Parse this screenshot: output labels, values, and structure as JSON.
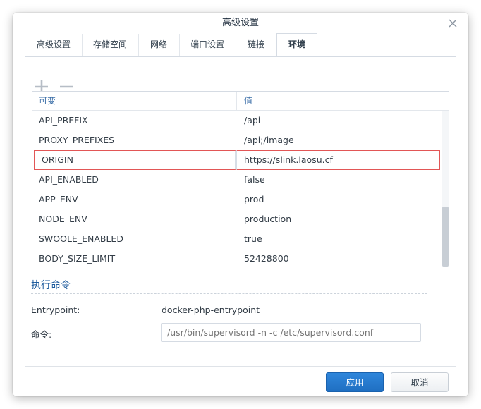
{
  "dialog": {
    "title": "高级设置",
    "close_icon": "close-icon"
  },
  "tabs": [
    {
      "label": "高级设置",
      "active": false
    },
    {
      "label": "存储空间",
      "active": false
    },
    {
      "label": "网络",
      "active": false
    },
    {
      "label": "端口设置",
      "active": false
    },
    {
      "label": "链接",
      "active": false
    },
    {
      "label": "环境",
      "active": true
    }
  ],
  "toolbar": {
    "add_icon": "plus-icon",
    "remove_icon": "minus-icon"
  },
  "table": {
    "columns": [
      "可变",
      "值"
    ],
    "rows": [
      {
        "name": "API_PREFIX",
        "value": "/api",
        "selected": false
      },
      {
        "name": "PROXY_PREFIXES",
        "value": "/api;/image",
        "selected": false
      },
      {
        "name": "ORIGIN",
        "value": "https://slink.laosu.cf",
        "selected": true
      },
      {
        "name": "API_ENABLED",
        "value": "false",
        "selected": false
      },
      {
        "name": "APP_ENV",
        "value": "prod",
        "selected": false
      },
      {
        "name": "NODE_ENV",
        "value": "production",
        "selected": false
      },
      {
        "name": "SWOOLE_ENABLED",
        "value": "true",
        "selected": false
      },
      {
        "name": "BODY_SIZE_LIMIT",
        "value": "52428800",
        "selected": false
      }
    ]
  },
  "exec": {
    "section_title": "执行命令",
    "entrypoint_label": "Entrypoint:",
    "entrypoint_value": "docker-php-entrypoint",
    "command_label": "命令:",
    "command_placeholder": "/usr/bin/supervisord -n -c /etc/supervisord.conf"
  },
  "footer": {
    "apply_label": "应用",
    "cancel_label": "取消"
  },
  "colors": {
    "accent": "#2476cf",
    "selection_border": "#e25656",
    "header_text": "#3c6fa8"
  }
}
